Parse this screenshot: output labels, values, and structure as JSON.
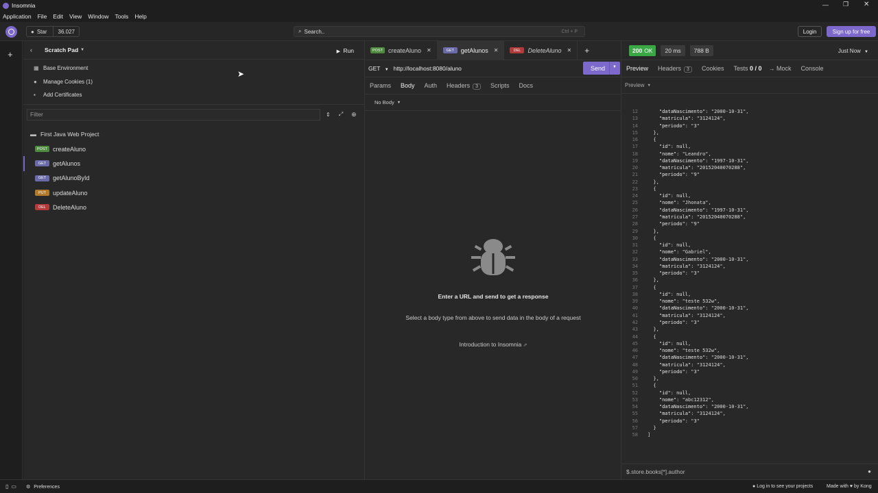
{
  "window": {
    "title": "Insomnia"
  },
  "menu": [
    "Application",
    "File",
    "Edit",
    "View",
    "Window",
    "Tools",
    "Help"
  ],
  "appbar": {
    "star_label": "Star",
    "star_count": "36.027",
    "search_placeholder": "Search..",
    "search_shortcut": "Ctrl + P",
    "login": "Login",
    "signup": "Sign up for free"
  },
  "sidebar": {
    "title": "Scratch Pad",
    "run": "Run",
    "links": [
      {
        "label": "Base Environment",
        "icon": "table-icon"
      },
      {
        "label": "Manage Cookies (1)",
        "icon": "cookie-icon"
      },
      {
        "label": "Add Certificates",
        "icon": "certificate-icon"
      }
    ],
    "filter_placeholder": "Filter",
    "project": "First Java Web Project",
    "requests": [
      {
        "method": "POST",
        "name": "createAluno"
      },
      {
        "method": "GET",
        "name": "getAlunos"
      },
      {
        "method": "GET",
        "name": "getAlunoById"
      },
      {
        "method": "PUT",
        "name": "updateAluno"
      },
      {
        "method": "DEL",
        "name": "DeleteAluno"
      }
    ]
  },
  "tabs": [
    {
      "method": "POST",
      "name": "createAluno"
    },
    {
      "method": "GET",
      "name": "getAlunos"
    },
    {
      "method": "DEL",
      "name": "DeleteAluno"
    }
  ],
  "request": {
    "method": "GET",
    "url": "http://localhost:8080/aluno",
    "send": "Send",
    "subtabs": [
      "Params",
      "Body",
      "Auth",
      "Headers",
      "Scripts",
      "Docs"
    ],
    "headers_count": "3",
    "body_type": "No Body",
    "empty_title": "Enter a URL and send to get a response",
    "empty_text": "Select a body type from above to send data in the body of a request",
    "intro_link": "Introduction to Insomnia"
  },
  "response": {
    "status_code": "200",
    "status_text": "OK",
    "time": "20 ms",
    "size": "788 B",
    "when": "Just Now",
    "subtabs": [
      "Preview",
      "Headers",
      "Cookies",
      "Tests",
      "→ Mock",
      "Console"
    ],
    "headers_count": "3",
    "tests_count": "0 / 0",
    "preview_mode": "Preview",
    "filter": "$.store.books[*].author",
    "lines": [
      {
        "n": "12",
        "t": "    \"dataNascimento\": \"2000-10-31\","
      },
      {
        "n": "13",
        "t": "    \"matricula\": \"3124124\","
      },
      {
        "n": "14",
        "t": "    \"periodo\": \"3\""
      },
      {
        "n": "15",
        "t": "  },"
      },
      {
        "n": "16",
        "t": "  {"
      },
      {
        "n": "17",
        "t": "    \"id\": null,"
      },
      {
        "n": "18",
        "t": "    \"nome\": \"Leandro\","
      },
      {
        "n": "19",
        "t": "    \"dataNascimento\": \"1997-10-31\","
      },
      {
        "n": "20",
        "t": "    \"matricula\": \"20152040070288\","
      },
      {
        "n": "21",
        "t": "    \"periodo\": \"9\""
      },
      {
        "n": "22",
        "t": "  },"
      },
      {
        "n": "23",
        "t": "  {"
      },
      {
        "n": "24",
        "t": "    \"id\": null,"
      },
      {
        "n": "25",
        "t": "    \"nome\": \"Jhonata\","
      },
      {
        "n": "26",
        "t": "    \"dataNascimento\": \"1997-10-31\","
      },
      {
        "n": "27",
        "t": "    \"matricula\": \"20152040070288\","
      },
      {
        "n": "28",
        "t": "    \"periodo\": \"9\""
      },
      {
        "n": "29",
        "t": "  },"
      },
      {
        "n": "30",
        "t": "  {"
      },
      {
        "n": "31",
        "t": "    \"id\": null,"
      },
      {
        "n": "32",
        "t": "    \"nome\": \"Gabriel\","
      },
      {
        "n": "33",
        "t": "    \"dataNascimento\": \"2000-10-31\","
      },
      {
        "n": "34",
        "t": "    \"matricula\": \"3124124\","
      },
      {
        "n": "35",
        "t": "    \"periodo\": \"3\""
      },
      {
        "n": "36",
        "t": "  },"
      },
      {
        "n": "37",
        "t": "  {"
      },
      {
        "n": "38",
        "t": "    \"id\": null,"
      },
      {
        "n": "39",
        "t": "    \"nome\": \"teste 532w\","
      },
      {
        "n": "40",
        "t": "    \"dataNascimento\": \"2000-10-31\","
      },
      {
        "n": "41",
        "t": "    \"matricula\": \"3124124\","
      },
      {
        "n": "42",
        "t": "    \"periodo\": \"3\""
      },
      {
        "n": "43",
        "t": "  },"
      },
      {
        "n": "44",
        "t": "  {"
      },
      {
        "n": "45",
        "t": "    \"id\": null,"
      },
      {
        "n": "46",
        "t": "    \"nome\": \"teste 532w\","
      },
      {
        "n": "47",
        "t": "    \"dataNascimento\": \"2000-10-31\","
      },
      {
        "n": "48",
        "t": "    \"matricula\": \"3124124\","
      },
      {
        "n": "49",
        "t": "    \"periodo\": \"3\""
      },
      {
        "n": "50",
        "t": "  },"
      },
      {
        "n": "51",
        "t": "  {"
      },
      {
        "n": "52",
        "t": "    \"id\": null,"
      },
      {
        "n": "53",
        "t": "    \"nome\": \"abc12312\","
      },
      {
        "n": "54",
        "t": "    \"dataNascimento\": \"2000-10-31\","
      },
      {
        "n": "55",
        "t": "    \"matricula\": \"3124124\","
      },
      {
        "n": "56",
        "t": "    \"periodo\": \"3\""
      },
      {
        "n": "57",
        "t": "  }"
      },
      {
        "n": "58",
        "t": "]"
      }
    ]
  },
  "statusbar": {
    "preferences": "Preferences",
    "login_hint": "Log in to see your projects",
    "made_with": "Made with",
    "by": "by Kong"
  },
  "colors": {
    "accent": "#7d69cb",
    "status_ok": "#3aa845",
    "post": "#4e8a3e",
    "get": "#6b6aa8",
    "put": "#b27a2b",
    "delete": "#b23a3a"
  }
}
